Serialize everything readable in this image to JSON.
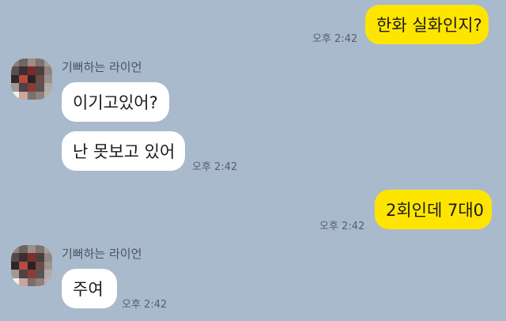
{
  "sender_name": "기뻐하는 라이언",
  "messages": [
    {
      "from": "me",
      "text": "한화 실화인지?",
      "time": "오후 2:42"
    },
    {
      "from": "other",
      "text": "이기고있어?"
    },
    {
      "from": "other",
      "text": "난 못보고 있어",
      "time": "오후 2:42"
    },
    {
      "from": "me",
      "text": "2회인데 7대0",
      "time": "오후 2:42"
    },
    {
      "from": "other",
      "text": "주여",
      "time": "오후 2:42"
    }
  ],
  "colors": {
    "background": "#a9bacd",
    "my_bubble": "#fee500",
    "their_bubble": "#ffffff"
  }
}
